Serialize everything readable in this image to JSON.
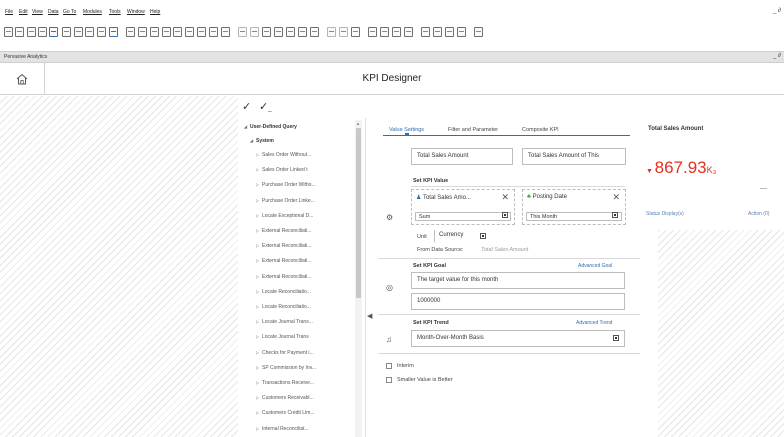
{
  "menu": {
    "items": [
      "File",
      "Edit",
      "View",
      "Data",
      "Go To",
      "Modules",
      "Tools",
      "Window",
      "Help"
    ],
    "window_controls": "_ ∂"
  },
  "window": {
    "title": "Pervasive Analytics",
    "controls": "_ ∂"
  },
  "header": {
    "title": "KPI Designer"
  },
  "tree": {
    "root": "User-Defined Query",
    "group": "System",
    "items": [
      "Sales Order Without...",
      "Sales Order Linked t",
      "Purchase Order Witho...",
      "Purchase Order Linke...",
      "Locate Exceptional D...",
      "External Reconciliati...",
      "External Reconciliati...",
      "External Reconciliati...",
      "External Reconciliati...",
      "Locate Reconciliatio...",
      "Locate Reconciliatio...",
      "Locate Journal Trans...",
      "Locate Journal Trans",
      "Checks for Payment i...",
      "SP Commission by Inv...",
      "Transactions Receive...",
      "Customers Receivabl...",
      "Customers Credit Lim...",
      "Internal Reconciliat..."
    ]
  },
  "tabs": [
    {
      "label": "Value Settings",
      "active": true
    },
    {
      "label": "Filter and Parameter",
      "active": false
    },
    {
      "label": "Composite KPI",
      "active": false
    }
  ],
  "names": {
    "name": "Total Sales Amount",
    "description": "Total Sales Amount of This"
  },
  "kpi_value": {
    "section_title": "Set KPI Value",
    "field_card": {
      "caption": "Total Sales Amo...",
      "selected": "Sum"
    },
    "date_card": {
      "caption": "Posting Date",
      "selected": "This Month"
    },
    "unit_label": "Unit",
    "unit_value": "Currency",
    "source_label": "From Data Source:",
    "source_value": "Total Sales Amount"
  },
  "kpi_goal": {
    "section_title": "Set KPI Goal",
    "link": "Advanced Goal",
    "description": "The target value for this month",
    "value": "1000000"
  },
  "kpi_trend": {
    "section_title": "Set KPI Trend",
    "link": "Advanced Trend",
    "value": "Month-Over-Month Basis"
  },
  "options": {
    "interim": "Interim",
    "smaller_better": "Smaller Value is Better"
  },
  "preview": {
    "title": "Total Sales Amount",
    "value": "867.93",
    "unit": "K₃",
    "dash": "—",
    "status": "Status Display(s)",
    "action": "Action (0)",
    "accent": "#e0301e"
  },
  "colors": {
    "link": "#2d6fb3",
    "kpi_red": "#e0301e"
  }
}
